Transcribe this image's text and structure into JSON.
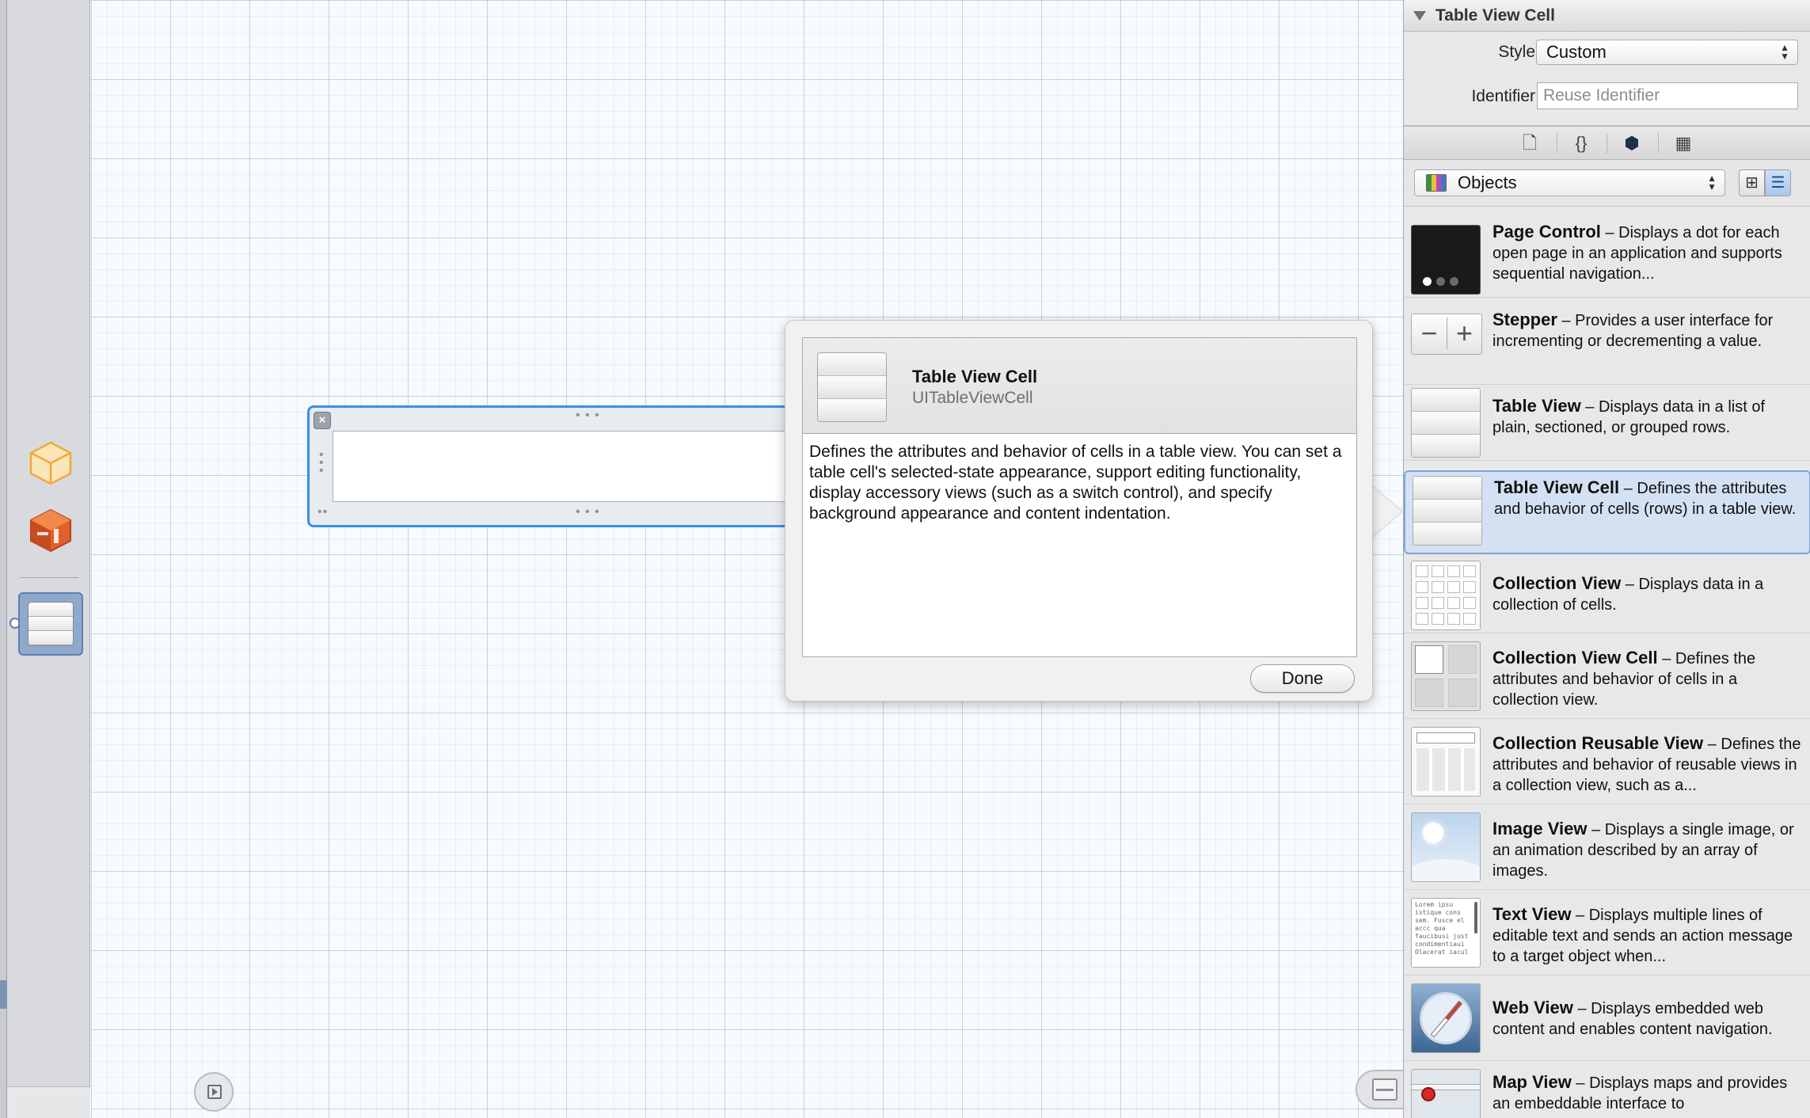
{
  "inspector": {
    "section_title": "Table View Cell",
    "style_label": "Style",
    "style_value": "Custom",
    "identifier_label": "Identifier",
    "identifier_placeholder": "Reuse Identifier",
    "tabs": [
      {
        "icon": "file-template-icon",
        "glyph": "🗋"
      },
      {
        "icon": "code-braces-icon",
        "glyph": "{}"
      },
      {
        "icon": "object-cube-icon",
        "glyph": "⬢"
      },
      {
        "icon": "media-film-icon",
        "glyph": "▦"
      }
    ],
    "library_filter": "Objects",
    "view_modes": [
      {
        "icon": "grid-view-icon",
        "glyph": "⊞",
        "selected": false
      },
      {
        "icon": "list-view-icon",
        "glyph": "☰",
        "selected": true
      }
    ]
  },
  "library": {
    "items": [
      {
        "name": "Page Control",
        "description": "Displays a dot for each open page in an application and supports sequential navigation...",
        "selected": false
      },
      {
        "name": "Stepper",
        "description": "Provides a user interface for incrementing or decrementing a value.",
        "selected": false
      },
      {
        "name": "Table View",
        "description": "Displays data in a list of plain, sectioned, or grouped rows.",
        "selected": false
      },
      {
        "name": "Table View Cell",
        "description": "Defines the attributes and behavior of cells (rows) in a table view.",
        "selected": true
      },
      {
        "name": "Collection View",
        "description": "Displays data in a collection of cells.",
        "selected": false
      },
      {
        "name": "Collection View Cell",
        "description": "Defines the attributes and behavior of cells in a collection view.",
        "selected": false
      },
      {
        "name": "Collection Reusable View",
        "description": "Defines the attributes and behavior of reusable views in a collection view, such as a...",
        "selected": false
      },
      {
        "name": "Image View",
        "description": "Displays a single image, or an animation described by an array of images.",
        "selected": false
      },
      {
        "name": "Text View",
        "description": "Displays multiple lines of editable text and sends an action message to a target object when...",
        "selected": false
      },
      {
        "name": "Web View",
        "description": "Displays embedded web content and enables content navigation.",
        "selected": false
      },
      {
        "name": "Map View",
        "description": "Displays maps and provides an embeddable interface to",
        "selected": false
      }
    ],
    "separator": " – ",
    "text_view_thumb_text": "Lorem ipsu istique cons sem. Fusce el accc qua faucibusi just condimentiaui Olacerat iacul"
  },
  "popover": {
    "title": "Table View Cell",
    "class_name": "UITableViewCell",
    "description": "Defines the attributes and behavior of cells in a table view. You can set a table cell's selected-state appearance, support editing functionality, display accessory views (such as a switch control), and specify background appearance and content indentation.",
    "done_label": "Done"
  },
  "canvas": {
    "close_glyph": "×"
  },
  "colors": {
    "selection_blue": "#3b8fe6",
    "selected_row": "#d4e1f3",
    "grid_line": "#78aad7",
    "dock_cube_orange": "#e2602a",
    "dock_cube_outline": "#f0a93a"
  }
}
